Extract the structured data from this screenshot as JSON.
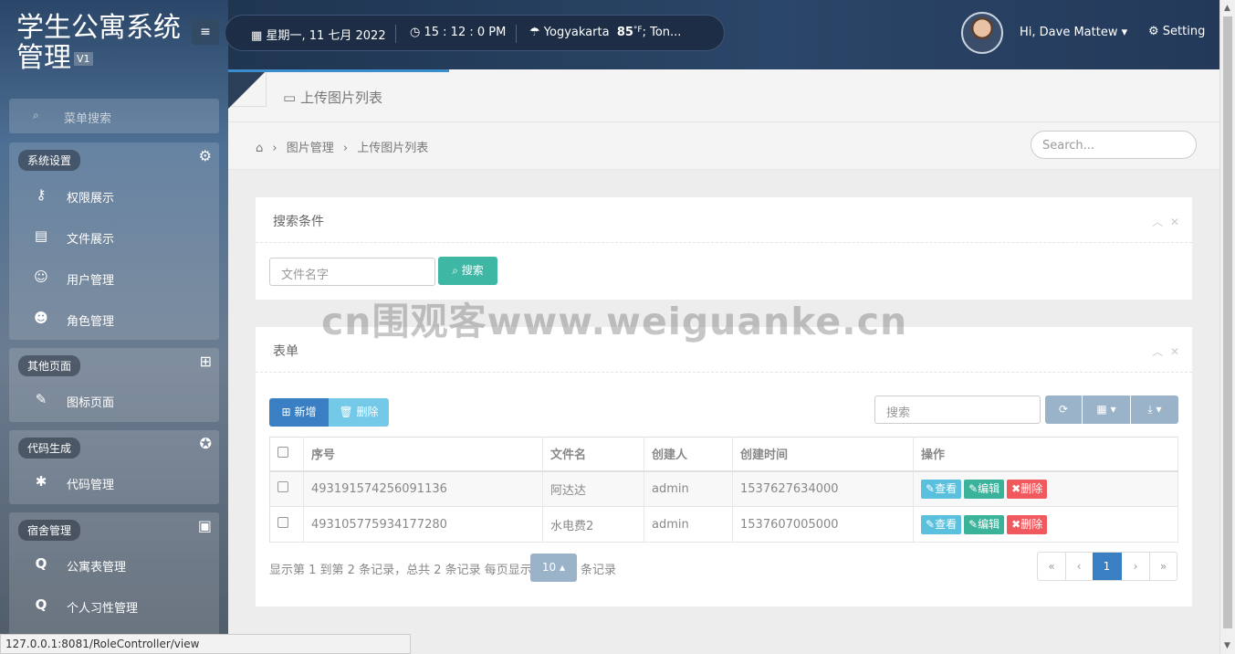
{
  "app": {
    "title": "学生公寓系统管理",
    "title_line1": "学生公寓系统",
    "title_line2": "管理",
    "version": "V1"
  },
  "topbar": {
    "date": "星期一, 11 七月 2022",
    "time": "15 : 12 : 0 PM",
    "city": "Yogyakarta",
    "temperature": "85",
    "temp_unit": "°F",
    "weather_rest": "; Ton...",
    "greeting": "Hi, Dave Mattew",
    "setting_label": "Setting"
  },
  "sidebar": {
    "search_placeholder": "菜单搜索",
    "groups": [
      {
        "label": "系统设置",
        "icon": "gear-icon",
        "items": [
          {
            "label": "权限展示",
            "icon": "key-icon"
          },
          {
            "label": "文件展示",
            "icon": "file-image-icon"
          },
          {
            "label": "用户管理",
            "icon": "user-icon"
          },
          {
            "label": "角色管理",
            "icon": "users-icon"
          }
        ]
      },
      {
        "label": "其他页面",
        "icon": "windows-icon",
        "items": [
          {
            "label": "图标页面",
            "icon": "magic-wand-icon"
          }
        ]
      },
      {
        "label": "代码生成",
        "icon": "rebel-icon",
        "items": [
          {
            "label": "代码管理",
            "icon": "bug-icon"
          }
        ]
      },
      {
        "label": "宿舍管理",
        "icon": "contact-card-icon",
        "items": [
          {
            "label": "公寓表管理",
            "icon": "q-icon"
          },
          {
            "label": "个人习性管理",
            "icon": "q-icon"
          }
        ]
      }
    ]
  },
  "tab": {
    "title": "上传图片列表"
  },
  "breadcrumb": {
    "items": [
      "图片管理",
      "上传图片列表"
    ],
    "search_placeholder": "Search..."
  },
  "search_panel": {
    "title": "搜索条件",
    "input_placeholder": "文件名字",
    "search_button": "搜索"
  },
  "table_panel": {
    "title": "表单",
    "add_button": "新增",
    "delete_button": "删除",
    "search_placeholder": "搜索",
    "columns": [
      "序号",
      "文件名",
      "创建人",
      "创建时间",
      "操作"
    ],
    "rows": [
      {
        "id": "493191574256091136",
        "name": "阿达达",
        "creator": "admin",
        "created": "1537627634000"
      },
      {
        "id": "493105775934177280",
        "name": "水电费2",
        "creator": "admin",
        "created": "1537607005000"
      }
    ],
    "actions": {
      "view": "查看",
      "edit": "编辑",
      "delete": "删除"
    },
    "pagination": {
      "info": "显示第 1 到第 2 条记录，总共 2 条记录 每页显示",
      "page_size": "10",
      "suffix": "条记录",
      "first": "«",
      "prev": "‹",
      "current": "1",
      "next": "›",
      "last": "»"
    }
  },
  "watermark": "cn围观客www.weiguanke.cn",
  "statusbar": {
    "url": "127.0.0.1:8081/RoleController/view"
  },
  "colors": {
    "primary": "#3a7fc3",
    "info": "#5bc0de",
    "success": "#3bb39a",
    "danger": "#f0595d",
    "teal": "#3fb7a5"
  }
}
